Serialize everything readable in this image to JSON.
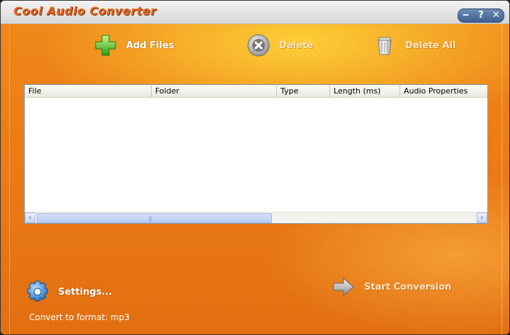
{
  "window": {
    "title": "Cool Audio Converter",
    "buttons": {
      "minimize": "‒",
      "help": "?",
      "close": "✕"
    }
  },
  "toolbar": {
    "add_files": "Add Files",
    "delete": "Delete",
    "delete_all": "Delete All"
  },
  "file_list": {
    "columns": [
      "File",
      "Folder",
      "Type",
      "Length (ms)",
      "Audio Properties"
    ],
    "rows": [],
    "scrollbar": {
      "left_arrow": "‹",
      "right_arrow": "›",
      "grip": "|||"
    }
  },
  "settings": {
    "label": "Settings..."
  },
  "conversion": {
    "start_label": "Start Conversion"
  },
  "format": {
    "text": "Convert to format: mp3"
  },
  "icons": {
    "add": "plus-icon",
    "delete": "delete-icon",
    "delete_all": "trash-icon",
    "settings": "gear-icon",
    "start": "arrow-right-icon"
  },
  "colors": {
    "background": "#ec7d16",
    "title": "#e3641b",
    "accent_blue": "#3f5f8f"
  }
}
